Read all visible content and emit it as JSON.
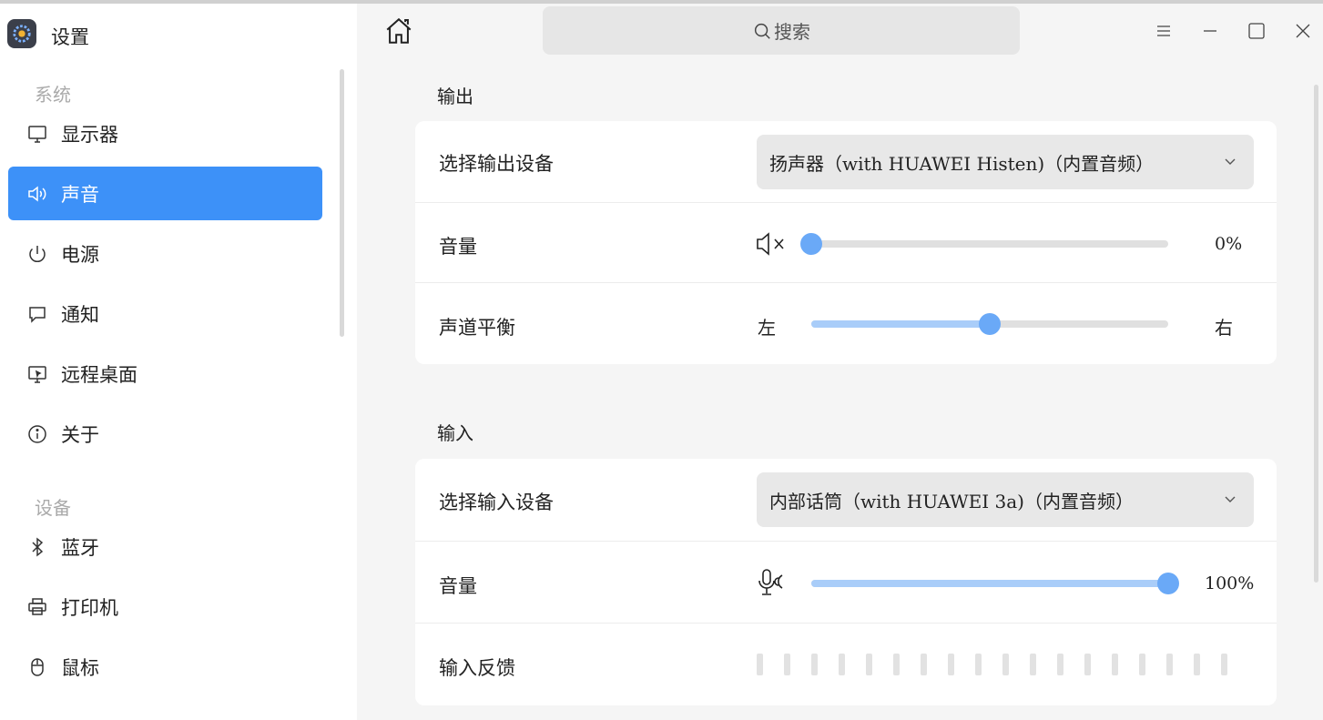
{
  "app": {
    "title": "设置"
  },
  "sidebar": {
    "groups": [
      {
        "label": "系统"
      },
      {
        "label": "设备"
      }
    ],
    "items": [
      {
        "label": "显示器",
        "icon": "monitor-icon"
      },
      {
        "label": "声音",
        "icon": "speaker-icon",
        "active": true
      },
      {
        "label": "电源",
        "icon": "power-icon"
      },
      {
        "label": "通知",
        "icon": "notification-icon"
      },
      {
        "label": "远程桌面",
        "icon": "remote-desktop-icon"
      },
      {
        "label": "关于",
        "icon": "info-icon"
      },
      {
        "label": "蓝牙",
        "icon": "bluetooth-icon"
      },
      {
        "label": "打印机",
        "icon": "printer-icon"
      },
      {
        "label": "鼠标",
        "icon": "mouse-icon"
      }
    ]
  },
  "toolbar": {
    "search_placeholder": "搜索"
  },
  "output": {
    "section_title": "输出",
    "device_label": "选择输出设备",
    "device_value": "扬声器（with HUAWEI Histen)（内置音频）",
    "volume_label": "音量",
    "volume_percent": 0,
    "volume_text": "0%",
    "balance_label": "声道平衡",
    "balance_left": "左",
    "balance_right": "右",
    "balance_value": 0.5
  },
  "input": {
    "section_title": "输入",
    "device_label": "选择输入设备",
    "device_value": "内部话筒（with HUAWEI 3a)（内置音频）",
    "volume_label": "音量",
    "volume_percent": 100,
    "volume_text": "100%",
    "feedback_label": "输入反馈",
    "feedback_level": 0
  },
  "colors": {
    "accent": "#3d91f8",
    "slider_fill": "#a9cdf9",
    "slider_thumb": "#6aa9f7"
  }
}
